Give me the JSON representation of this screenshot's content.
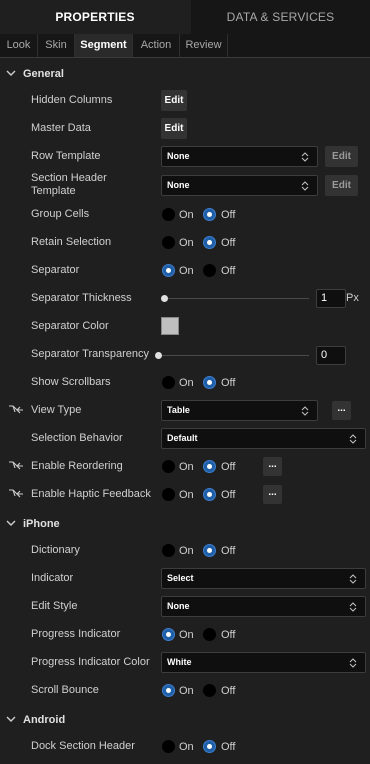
{
  "top_tabs": [
    {
      "label": "PROPERTIES",
      "active": true
    },
    {
      "label": "DATA & SERVICES",
      "active": false
    }
  ],
  "sub_tabs": [
    {
      "label": "Look"
    },
    {
      "label": "Skin"
    },
    {
      "label": "Segment",
      "active": true
    },
    {
      "label": "Action"
    },
    {
      "label": "Review"
    }
  ],
  "general": {
    "title": "General",
    "hidden_columns": {
      "label": "Hidden Columns",
      "button": "Edit"
    },
    "master_data": {
      "label": "Master Data",
      "button": "Edit"
    },
    "row_template": {
      "label": "Row Template",
      "value": "None",
      "button": "Edit"
    },
    "section_header_template": {
      "label": "Section Header Template",
      "value": "None",
      "button": "Edit"
    },
    "group_cells": {
      "label": "Group Cells",
      "on": "On",
      "off": "Off",
      "selected": "Off"
    },
    "retain_selection": {
      "label": "Retain Selection",
      "on": "On",
      "off": "Off",
      "selected": "Off"
    },
    "separator": {
      "label": "Separator",
      "on": "On",
      "off": "Off",
      "selected": "On"
    },
    "separator_thickness": {
      "label": "Separator Thickness",
      "value": "1",
      "unit": "Px",
      "level": 0
    },
    "separator_color": {
      "label": "Separator Color",
      "color": "#bfbfbf"
    },
    "separator_transparency": {
      "label": "Separator Transparency",
      "value": "0",
      "level": 0
    },
    "show_scrollbars": {
      "label": "Show Scrollbars",
      "on": "On",
      "off": "Off",
      "selected": "Off"
    },
    "view_type": {
      "label": "View Type",
      "value": "Table",
      "more": "..."
    },
    "selection_behavior": {
      "label": "Selection Behavior",
      "value": "Default"
    },
    "enable_reordering": {
      "label": "Enable Reordering",
      "on": "On",
      "off": "Off",
      "selected": "Off",
      "more": "..."
    },
    "enable_haptic_feedback": {
      "label": "Enable Haptic Feedback",
      "on": "On",
      "off": "Off",
      "selected": "Off",
      "more": "..."
    }
  },
  "iphone": {
    "title": "iPhone",
    "dictionary": {
      "label": "Dictionary",
      "on": "On",
      "off": "Off",
      "selected": "Off"
    },
    "indicator": {
      "label": "Indicator",
      "value": "Select"
    },
    "edit_style": {
      "label": "Edit Style",
      "value": "None"
    },
    "progress_indicator": {
      "label": "Progress Indicator",
      "on": "On",
      "off": "Off",
      "selected": "On"
    },
    "progress_indicator_color": {
      "label": "Progress Indicator Color",
      "value": "White"
    },
    "scroll_bounce": {
      "label": "Scroll Bounce",
      "on": "On",
      "off": "Off",
      "selected": "On"
    }
  },
  "android": {
    "title": "Android",
    "dock_section_header": {
      "label": "Dock Section Header",
      "on": "On",
      "off": "Off",
      "selected": "Off"
    }
  },
  "colors": {
    "accent": "#1f5fa8",
    "background": "#1f1f1f"
  }
}
